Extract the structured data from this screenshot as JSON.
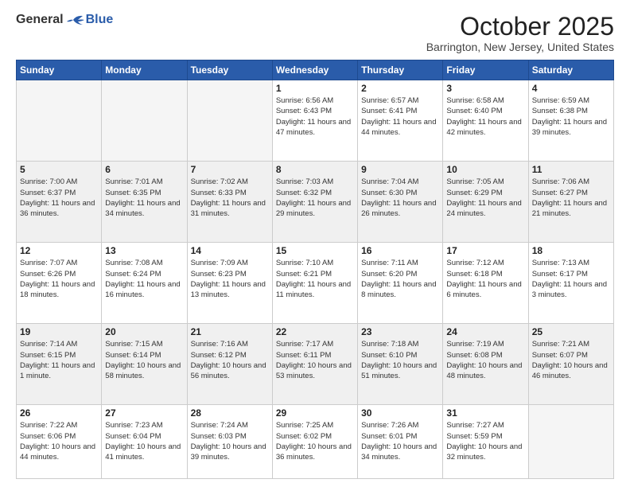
{
  "logo": {
    "general": "General",
    "blue": "Blue"
  },
  "header": {
    "month": "October 2025",
    "location": "Barrington, New Jersey, United States"
  },
  "days_of_week": [
    "Sunday",
    "Monday",
    "Tuesday",
    "Wednesday",
    "Thursday",
    "Friday",
    "Saturday"
  ],
  "weeks": [
    [
      {
        "day": "",
        "info": ""
      },
      {
        "day": "",
        "info": ""
      },
      {
        "day": "",
        "info": ""
      },
      {
        "day": "1",
        "info": "Sunrise: 6:56 AM\nSunset: 6:43 PM\nDaylight: 11 hours and 47 minutes."
      },
      {
        "day": "2",
        "info": "Sunrise: 6:57 AM\nSunset: 6:41 PM\nDaylight: 11 hours and 44 minutes."
      },
      {
        "day": "3",
        "info": "Sunrise: 6:58 AM\nSunset: 6:40 PM\nDaylight: 11 hours and 42 minutes."
      },
      {
        "day": "4",
        "info": "Sunrise: 6:59 AM\nSunset: 6:38 PM\nDaylight: 11 hours and 39 minutes."
      }
    ],
    [
      {
        "day": "5",
        "info": "Sunrise: 7:00 AM\nSunset: 6:37 PM\nDaylight: 11 hours and 36 minutes."
      },
      {
        "day": "6",
        "info": "Sunrise: 7:01 AM\nSunset: 6:35 PM\nDaylight: 11 hours and 34 minutes."
      },
      {
        "day": "7",
        "info": "Sunrise: 7:02 AM\nSunset: 6:33 PM\nDaylight: 11 hours and 31 minutes."
      },
      {
        "day": "8",
        "info": "Sunrise: 7:03 AM\nSunset: 6:32 PM\nDaylight: 11 hours and 29 minutes."
      },
      {
        "day": "9",
        "info": "Sunrise: 7:04 AM\nSunset: 6:30 PM\nDaylight: 11 hours and 26 minutes."
      },
      {
        "day": "10",
        "info": "Sunrise: 7:05 AM\nSunset: 6:29 PM\nDaylight: 11 hours and 24 minutes."
      },
      {
        "day": "11",
        "info": "Sunrise: 7:06 AM\nSunset: 6:27 PM\nDaylight: 11 hours and 21 minutes."
      }
    ],
    [
      {
        "day": "12",
        "info": "Sunrise: 7:07 AM\nSunset: 6:26 PM\nDaylight: 11 hours and 18 minutes."
      },
      {
        "day": "13",
        "info": "Sunrise: 7:08 AM\nSunset: 6:24 PM\nDaylight: 11 hours and 16 minutes."
      },
      {
        "day": "14",
        "info": "Sunrise: 7:09 AM\nSunset: 6:23 PM\nDaylight: 11 hours and 13 minutes."
      },
      {
        "day": "15",
        "info": "Sunrise: 7:10 AM\nSunset: 6:21 PM\nDaylight: 11 hours and 11 minutes."
      },
      {
        "day": "16",
        "info": "Sunrise: 7:11 AM\nSunset: 6:20 PM\nDaylight: 11 hours and 8 minutes."
      },
      {
        "day": "17",
        "info": "Sunrise: 7:12 AM\nSunset: 6:18 PM\nDaylight: 11 hours and 6 minutes."
      },
      {
        "day": "18",
        "info": "Sunrise: 7:13 AM\nSunset: 6:17 PM\nDaylight: 11 hours and 3 minutes."
      }
    ],
    [
      {
        "day": "19",
        "info": "Sunrise: 7:14 AM\nSunset: 6:15 PM\nDaylight: 11 hours and 1 minute."
      },
      {
        "day": "20",
        "info": "Sunrise: 7:15 AM\nSunset: 6:14 PM\nDaylight: 10 hours and 58 minutes."
      },
      {
        "day": "21",
        "info": "Sunrise: 7:16 AM\nSunset: 6:12 PM\nDaylight: 10 hours and 56 minutes."
      },
      {
        "day": "22",
        "info": "Sunrise: 7:17 AM\nSunset: 6:11 PM\nDaylight: 10 hours and 53 minutes."
      },
      {
        "day": "23",
        "info": "Sunrise: 7:18 AM\nSunset: 6:10 PM\nDaylight: 10 hours and 51 minutes."
      },
      {
        "day": "24",
        "info": "Sunrise: 7:19 AM\nSunset: 6:08 PM\nDaylight: 10 hours and 48 minutes."
      },
      {
        "day": "25",
        "info": "Sunrise: 7:21 AM\nSunset: 6:07 PM\nDaylight: 10 hours and 46 minutes."
      }
    ],
    [
      {
        "day": "26",
        "info": "Sunrise: 7:22 AM\nSunset: 6:06 PM\nDaylight: 10 hours and 44 minutes."
      },
      {
        "day": "27",
        "info": "Sunrise: 7:23 AM\nSunset: 6:04 PM\nDaylight: 10 hours and 41 minutes."
      },
      {
        "day": "28",
        "info": "Sunrise: 7:24 AM\nSunset: 6:03 PM\nDaylight: 10 hours and 39 minutes."
      },
      {
        "day": "29",
        "info": "Sunrise: 7:25 AM\nSunset: 6:02 PM\nDaylight: 10 hours and 36 minutes."
      },
      {
        "day": "30",
        "info": "Sunrise: 7:26 AM\nSunset: 6:01 PM\nDaylight: 10 hours and 34 minutes."
      },
      {
        "day": "31",
        "info": "Sunrise: 7:27 AM\nSunset: 5:59 PM\nDaylight: 10 hours and 32 minutes."
      },
      {
        "day": "",
        "info": ""
      }
    ]
  ]
}
